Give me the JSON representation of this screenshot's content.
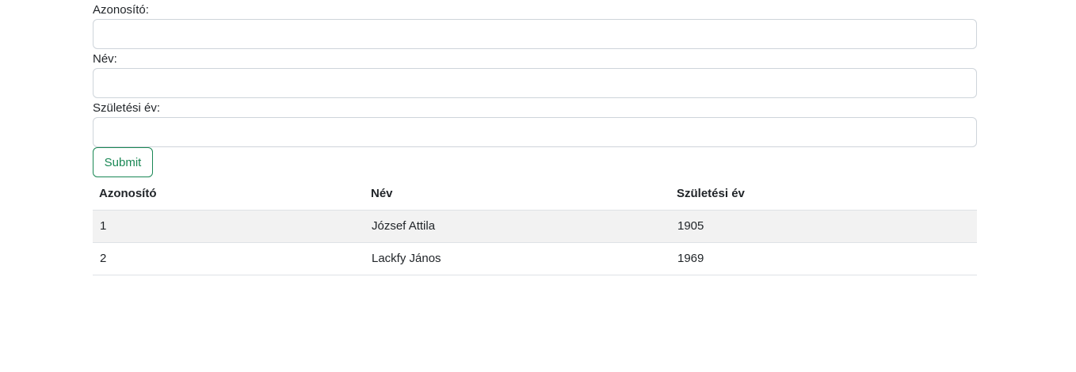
{
  "form": {
    "id_label": "Azonosító:",
    "id_value": "",
    "name_label": "Név:",
    "name_value": "",
    "birth_label": "Születési év:",
    "birth_value": "",
    "submit_label": "Submit"
  },
  "table": {
    "headers": [
      "Azonosító",
      "Név",
      "Születési év"
    ],
    "rows": [
      [
        "1",
        "József Attila",
        "1905"
      ],
      [
        "2",
        "Lackfy János",
        "1969"
      ]
    ]
  },
  "colors": {
    "accent": "#198754",
    "stripe": "#f2f2f2",
    "border": "#ced4da"
  }
}
